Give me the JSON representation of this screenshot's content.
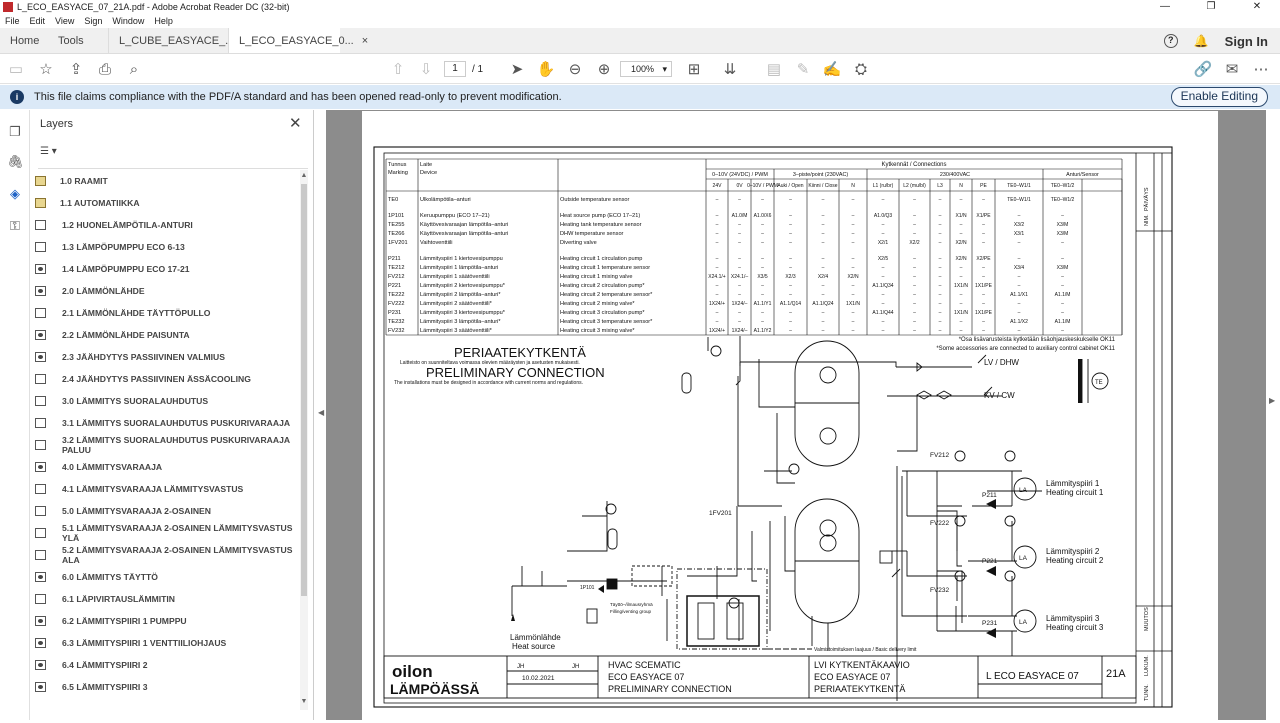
{
  "window": {
    "title": "L_ECO_EASYACE_07_21A.pdf - Adobe Acrobat Reader DC (32-bit)",
    "controls": [
      "—",
      "❐",
      "✕"
    ]
  },
  "menu": [
    "File",
    "Edit",
    "View",
    "Sign",
    "Window",
    "Help"
  ],
  "tabs": {
    "home": "Home",
    "tools": "Tools",
    "doc1": "L_CUBE_EASYACE_...",
    "doc2": "L_ECO_EASYACE_0...",
    "close": "×",
    "sign_in": "Sign In"
  },
  "toolbar": {
    "page_current": "1",
    "page_total": "/ 1",
    "zoom": "100%"
  },
  "banner": {
    "message": "This file claims compliance with the PDF/A standard and has been opened read-only to prevent modification.",
    "button": "Enable Editing"
  },
  "layers_panel": {
    "title": "Layers",
    "items": [
      {
        "label": "1.0 RAAMIT",
        "state": "lock"
      },
      {
        "label": "1.1 AUTOMATIIKKA",
        "state": "lock"
      },
      {
        "label": "1.2 HUONELÄMPÖTILA-ANTURI",
        "state": "off"
      },
      {
        "label": "1.3 LÄMPÖPUMPPU ECO 6-13",
        "state": "off"
      },
      {
        "label": "1.4 LÄMPÖPUMPPU ECO 17-21",
        "state": "on"
      },
      {
        "label": "2.0 LÄMMÖNLÄHDE",
        "state": "on"
      },
      {
        "label": "2.1 LÄMMÖNLÄHDE TÄYTTÖPULLO",
        "state": "off"
      },
      {
        "label": "2.2 LÄMMÖNLÄHDE PAISUNTA",
        "state": "on"
      },
      {
        "label": "2.3 JÄÄHDYTYS PASSIIVINEN VALMIUS",
        "state": "on"
      },
      {
        "label": "2.4 JÄÄHDYTYS PASSIIVINEN ÄSSÄCOOLING",
        "state": "off"
      },
      {
        "label": "3.0 LÄMMITYS SUORALAUHDUTUS",
        "state": "off"
      },
      {
        "label": "3.1 LÄMMITYS SUORALAUHDUTUS PUSKURIVARAAJA",
        "state": "off"
      },
      {
        "label": "3.2 LÄMMITYS SUORALAUHDUTUS PUSKURIVARAAJA PALUU",
        "state": "off"
      },
      {
        "label": "4.0 LÄMMITYSVARAAJA",
        "state": "on"
      },
      {
        "label": "4.1 LÄMMITYSVARAAJA LÄMMITYSVASTUS",
        "state": "off"
      },
      {
        "label": "5.0 LÄMMITYSVARAAJA 2-OSAINEN",
        "state": "off"
      },
      {
        "label": "5.1 LÄMMITYSVARAAJA 2-OSAINEN LÄMMITYSVASTUS YLÄ",
        "state": "off"
      },
      {
        "label": "5.2 LÄMMITYSVARAAJA 2-OSAINEN LÄMMITYSVASTUS ALA",
        "state": "off"
      },
      {
        "label": "6.0 LÄMMITYS TÄYTTÖ",
        "state": "on"
      },
      {
        "label": "6.1 LÄPIVIRTAUSLÄMMITIN",
        "state": "off"
      },
      {
        "label": "6.2 LÄMMITYSPIIRI 1 PUMPPU",
        "state": "on"
      },
      {
        "label": "6.3 LÄMMITYSPIIRI 1 VENTTIILIOHJAUS",
        "state": "on"
      },
      {
        "label": "6.4 LÄMMITYSPIIRI 2",
        "state": "on"
      },
      {
        "label": "6.5 LÄMMITYSPIIRI 3",
        "state": "on"
      }
    ]
  },
  "drawing": {
    "table": {
      "h_tunnus": "Tunnus",
      "h_marking": "Marking",
      "h_laite": "Laite",
      "h_device": "Device",
      "h_kytkennat": "Kytkennät / Connections",
      "h_010": "0–10V (24VDC) / PWM",
      "h_3piste": "3–piste/point (230VAC)",
      "h_230": "230/400VAC",
      "h_anturi": "Anturi/Sensor",
      "sub": [
        "24V",
        "0V",
        "0–10V / PWM",
        "Auki / Open",
        "Kiinni / Close",
        "N",
        "L1 (ru/br)",
        "L2 (mu/bl)",
        "L3",
        "N",
        "PE",
        "TE0–W1/1",
        "TE0–W1/2"
      ],
      "rows": [
        [
          "TE0",
          "Ulkolämpötila–anturi",
          "Outside temperature sensor",
          "–",
          "–",
          "–",
          "–",
          "–",
          "–",
          "–",
          "–",
          "–",
          "–",
          "–",
          "TE0–W1/1",
          "TE0–W1/2"
        ],
        [
          "1P101",
          "Keruupumppu (ECO 17–21)",
          "Heat source pump (ECO 17–21)",
          "–",
          "A1.0/M",
          "A1.0/X6",
          "–",
          "–",
          "–",
          "A1.0/Q3",
          "–",
          "–",
          "X1/N",
          "X1/PE",
          "–",
          "–"
        ],
        [
          "TE255",
          "Käyttövesivaraajan lämpötila–anturi",
          "Heating tank temperature sensor",
          "–",
          "–",
          "–",
          "–",
          "–",
          "–",
          "–",
          "–",
          "–",
          "–",
          "–",
          "X3/2",
          "X3/M"
        ],
        [
          "TE266",
          "Käyttövesivaraajan lämpötila–anturi",
          "DHW temperature sensor",
          "–",
          "–",
          "–",
          "–",
          "–",
          "–",
          "–",
          "–",
          "–",
          "–",
          "–",
          "X3/1",
          "X3/M"
        ],
        [
          "1FV201",
          "Vaihtoventtiili",
          "Diverting valve",
          "–",
          "–",
          "–",
          "–",
          "–",
          "–",
          "X2/1",
          "X2/2",
          "–",
          "X2/N",
          "–",
          "–",
          "–"
        ],
        [
          "P211",
          "Lämmityspiiri 1 kiertovesipumppu",
          "Heating circuit 1 circulation pump",
          "–",
          "–",
          "–",
          "–",
          "–",
          "–",
          "X2/5",
          "–",
          "–",
          "X2/N",
          "X2/PE",
          "–",
          "–"
        ],
        [
          "TE212",
          "Lämmityspiiri 1 lämpötila–anturi",
          "Heating circuit 1 temperature sensor",
          "–",
          "–",
          "–",
          "–",
          "–",
          "–",
          "–",
          "–",
          "–",
          "–",
          "–",
          "X3/4",
          "X3/M"
        ],
        [
          "FV212",
          "Lämmityspiiri 1 säätöventtiili",
          "Heating circuit 1 mixing valve",
          "X24.1/+",
          "X24.1/–",
          "X3/5",
          "X2/3",
          "X2/4",
          "X2/N",
          "–",
          "–",
          "–",
          "–",
          "–",
          "–",
          "–"
        ],
        [
          "P221",
          "Lämmityspiiri 2 kiertovesipumppu*",
          "Heating circuit 2 circulation pump*",
          "–",
          "–",
          "–",
          "–",
          "–",
          "–",
          "A1.1/Q34",
          "–",
          "–",
          "1X1/N",
          "1X1/PE",
          "–",
          "–"
        ],
        [
          "TE222",
          "Lämmityspiiri 2 lämpötila–anturi*",
          "Heating circuit 2 temperature sensor*",
          "–",
          "–",
          "–",
          "–",
          "–",
          "–",
          "–",
          "–",
          "–",
          "–",
          "–",
          "A1.1/X1",
          "A1.1/M"
        ],
        [
          "FV222",
          "Lämmityspiiri 2 säätöventtiili*",
          "Heating circuit 2 mixing valve*",
          "1X24/+",
          "1X24/–",
          "A1.1/Y1",
          "A1.1/Q14",
          "A1.1/Q24",
          "1X1/N",
          "–",
          "–",
          "–",
          "–",
          "–",
          "–",
          "–"
        ],
        [
          "P231",
          "Lämmityspiiri 3 kiertovesipumppu*",
          "Heating circuit 3 circulation pump*",
          "–",
          "–",
          "–",
          "–",
          "–",
          "–",
          "A1.1/Q44",
          "–",
          "–",
          "1X1/N",
          "1X1/PE",
          "–",
          "–"
        ],
        [
          "TE232",
          "Lämmityspiiri 3 lämpötila–anturi*",
          "Heating circuit 3 temperature sensor*",
          "–",
          "–",
          "–",
          "–",
          "–",
          "–",
          "–",
          "–",
          "–",
          "–",
          "–",
          "A1.1/X2",
          "A1.1/M"
        ],
        [
          "FV232",
          "Lämmityspiiri 3 säätöventtiili*",
          "Heating circuit 3 mixing valve*",
          "1X24/+",
          "1X24/–",
          "A1.1/Y2",
          "–",
          "–",
          "–",
          "–",
          "–",
          "–",
          "–",
          "–",
          "–",
          "–"
        ]
      ],
      "note1": "*Osa lisävarusteista kytketään lisäohjauskeskukselle OK11",
      "note2": "*Some accessories are connected to auxiliary control cabinet OK11"
    },
    "heading_fi": "PERIAATEKYTKENTÄ",
    "sub_fi": "Laitteisto on suunniteltava voimassa olevien määräysten ja asetusten mukaisesti.",
    "heading_en": "PRELIMINARY CONNECTION",
    "sub_en": "The installations must be designed in accordance with current norms and regulations.",
    "lv": "LV / DHW",
    "kv": "KV / CW",
    "te": "TE",
    "fv212": "FV212",
    "fv222": "FV222",
    "fv232": "FV232",
    "p211": "P211",
    "p221": "P221",
    "p231": "P231",
    "fv201": "1FV201",
    "p101": "1P101",
    "la": "LA",
    "hc1_fi": "Lämmityspiiri 1",
    "hc1_en": "Heating circuit 1",
    "hc2_fi": "Lämmityspiiri 2",
    "hc2_en": "Heating circuit 2",
    "hc3_fi": "Lämmityspiiri 3",
    "hc3_en": "Heating circuit 3",
    "source_fi": "Lämmönlähde",
    "source_en": "Heat source",
    "fill_fi": "Täyttö–/ilmausryhmä",
    "fill_en": "Filling/venting group",
    "delivery": "Valmistoimituksen laajuus / Basic delivery limit",
    "logo1": "oilon",
    "logo2": "LÄMPÖÄSSÄ",
    "tb_drawn": "JH",
    "tb_checked": "JH",
    "tb_date": "10.02.2021",
    "tb_c1": [
      "HVAC SCEMATIC",
      "ECO EASYACE 07",
      "PRELIMINARY CONNECTION"
    ],
    "tb_c2": [
      "LVI KYTKENTÄKAAVIO",
      "ECO EASYACE 07",
      "PERIAATEKYTKENTÄ"
    ],
    "tb_code": "L ECO EASYACE 07",
    "tb_rev": "21A",
    "side": [
      "PÄIVÄYS",
      "NIM.",
      "MUUTOS",
      "LUKUM.",
      "TUNN."
    ]
  }
}
